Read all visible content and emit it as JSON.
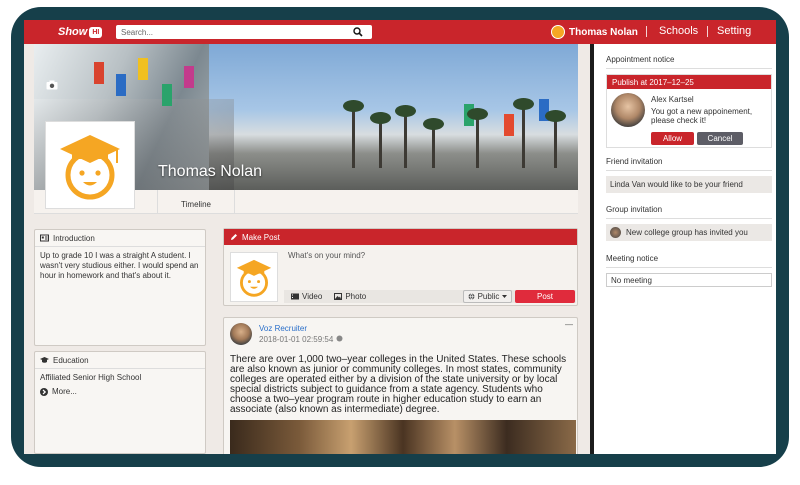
{
  "topbar": {
    "logo_text": "Show",
    "logo_badge": "HI",
    "search_placeholder": "Search...",
    "user_name": "Thomas Nolan",
    "nav": [
      "Schools",
      "Setting"
    ]
  },
  "profile": {
    "name": "Thomas Nolan",
    "tab_timeline": "Timeline"
  },
  "introduction": {
    "title": "Introduction",
    "text": "Up to grade 10 I was a straight A student. I wasn't very studious either. I would spend an hour in homework and that's about it."
  },
  "education": {
    "title": "Education",
    "school": "Affiliated Senior High School",
    "more": "More..."
  },
  "make_post": {
    "title": "Make Post",
    "placeholder": "What's on your mind?",
    "video": "Video",
    "photo": "Photo",
    "audience": "Public",
    "post_button": "Post"
  },
  "feed_post": {
    "author": "Voz Recruiter",
    "timestamp": "2018-01-01 02:59:54",
    "menu": "—",
    "body": "There are over 1,000 two–year colleges in the United States. These schools are also known as junior or community colleges. In most states, community colleges are operated either by a division of the state university or by local special districts subject to guidance from a state agency. Students who choose a two–year program route in higher education study to earn an associate (also known as intermediate) degree."
  },
  "sidebar": {
    "appointment": {
      "title": "Appointment notice",
      "card_header": "Publish at 2017–12–25",
      "sender": "Alex Kartsel",
      "message": "You got a new appoinement, please check it!",
      "allow": "Allow",
      "cancel": "Cancel"
    },
    "friend": {
      "title": "Friend invitation",
      "text": "Linda Van would like to be your friend"
    },
    "group": {
      "title": "Group invitation",
      "text": "New college group has invited you"
    },
    "meeting": {
      "title": "Meeting notice",
      "text": "No meeting"
    }
  },
  "colors": {
    "brand_red": "#c9252b",
    "bezel": "#163f4a",
    "avatar_orange": "#f5a623",
    "cancel_gray": "#5d5d66",
    "link_blue": "#2a6fc9"
  }
}
